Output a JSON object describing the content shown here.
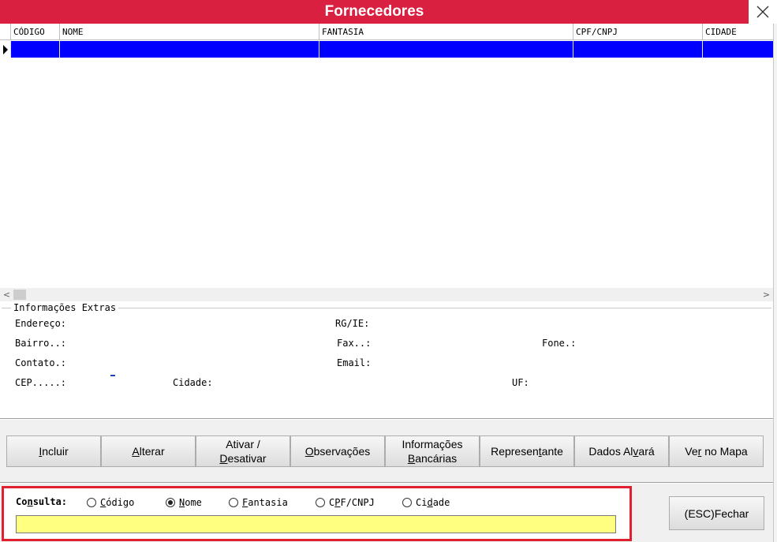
{
  "window": {
    "title": "Fornecedores",
    "close_icon": "close-icon"
  },
  "grid": {
    "columns": [
      "CÓDIGO",
      "NOME",
      "FANTASIA",
      "CPF/CNPJ",
      "CIDADE"
    ],
    "selected_row_color": "#0000ff"
  },
  "extras": {
    "group_title": "Informações Extras",
    "endereco": "Endereço:",
    "rg_ie": "RG/IE:",
    "bairro": "Bairro..:",
    "fax": "Fax..:",
    "fone": "Fone.:",
    "contato": "Contato.:",
    "email": "Email:",
    "cep": "CEP.....:",
    "cidade": "Cidade:",
    "uf": "UF:"
  },
  "buttons": {
    "incluir": {
      "pre": "",
      "key": "I",
      "post": "ncluir"
    },
    "alterar": {
      "pre": "",
      "key": "A",
      "post": "lterar"
    },
    "ativar": {
      "line1": "Ativar /",
      "pre": "",
      "key": "D",
      "post": "esativar"
    },
    "observacoes": {
      "pre": "",
      "key": "O",
      "post": "bservações"
    },
    "bancarias": {
      "line1": "Informações",
      "pre": "",
      "key": "B",
      "post": "ancárias"
    },
    "representante": {
      "pre": "Represen",
      "key": "t",
      "post": "ante"
    },
    "alvara": {
      "pre": "Dados Al",
      "key": "v",
      "post": "ará"
    },
    "mapa": {
      "pre": "Ve",
      "key": "r",
      "post": " no Mapa"
    }
  },
  "consulta": {
    "label_pre": "Co",
    "label_key": "n",
    "label_post": "sulta:",
    "options": [
      {
        "pre": "",
        "key": "C",
        "post": "ódigo",
        "selected": false
      },
      {
        "pre": "",
        "key": "N",
        "post": "ome",
        "selected": true
      },
      {
        "pre": "",
        "key": "F",
        "post": "antasia",
        "selected": false
      },
      {
        "pre": "C",
        "key": "P",
        "post": "F/CNPJ",
        "selected": false
      },
      {
        "pre": "Ci",
        "key": "d",
        "post": "ade",
        "selected": false
      }
    ],
    "search_value": "",
    "search_bg": "#ffff80",
    "highlight_color": "#e0202e"
  },
  "fechar_label": "(ESC)Fechar"
}
